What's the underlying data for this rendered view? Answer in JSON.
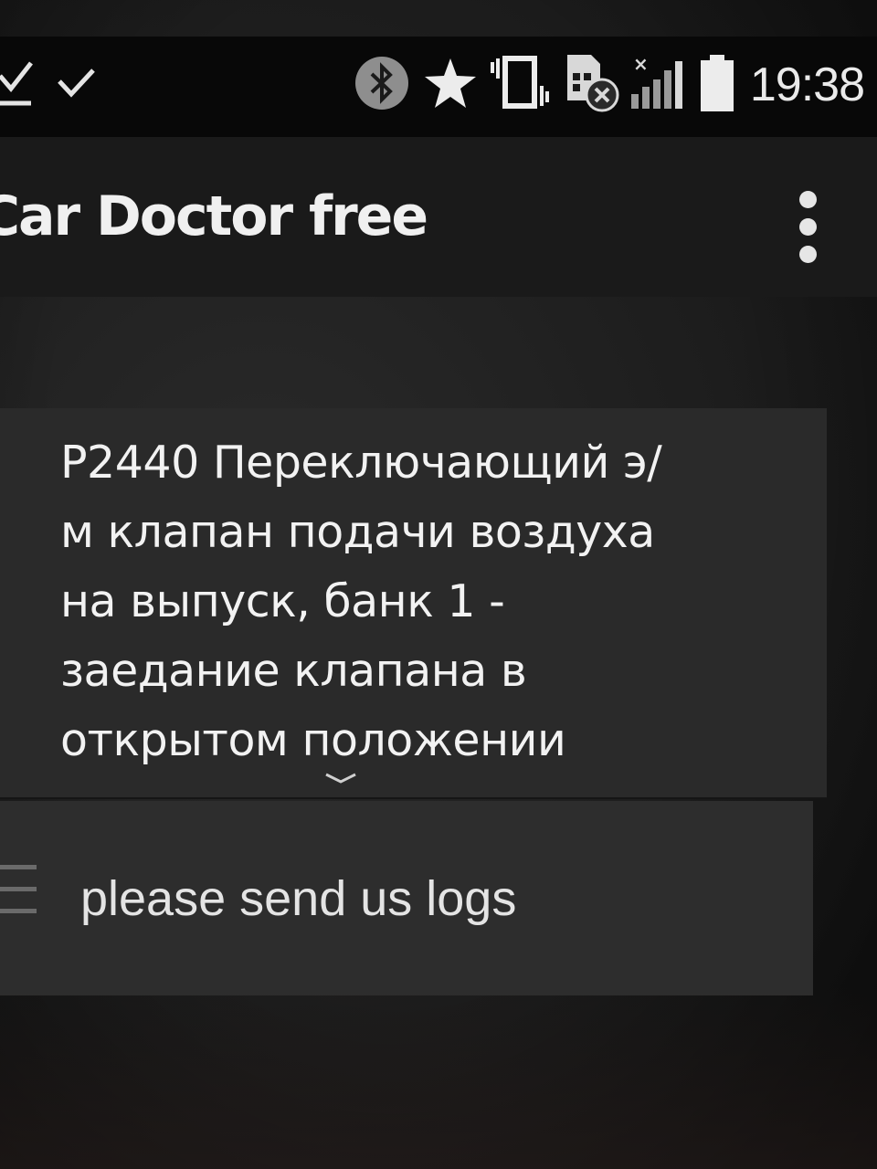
{
  "status_bar": {
    "left_icons": [
      "download-done-icon",
      "check-icon"
    ],
    "right_icons": [
      "bluetooth-icon",
      "star-icon",
      "vibrate-icon",
      "sim-card-off-icon",
      "signal-icon",
      "battery-icon"
    ],
    "time": "19:38"
  },
  "app_bar": {
    "title": "Car Doctor free",
    "menu_icon": "more-vertical-icon"
  },
  "error_card": {
    "lines": [
      "P2440 Переключающий э/",
      "м клапан подачи воздуха",
      "на выпуск, банк 1 -",
      "заедание клапана в",
      "открытом положении"
    ],
    "expand_icon": "chevron-down-icon"
  },
  "message_row": {
    "icon": "menu-icon",
    "text": "please send us logs"
  },
  "colors": {
    "status_bar_bg": "#080808",
    "app_bar_bg": "#1a1a1a",
    "card_bg": "#2a2a2a",
    "text": "#f2f2f2"
  }
}
